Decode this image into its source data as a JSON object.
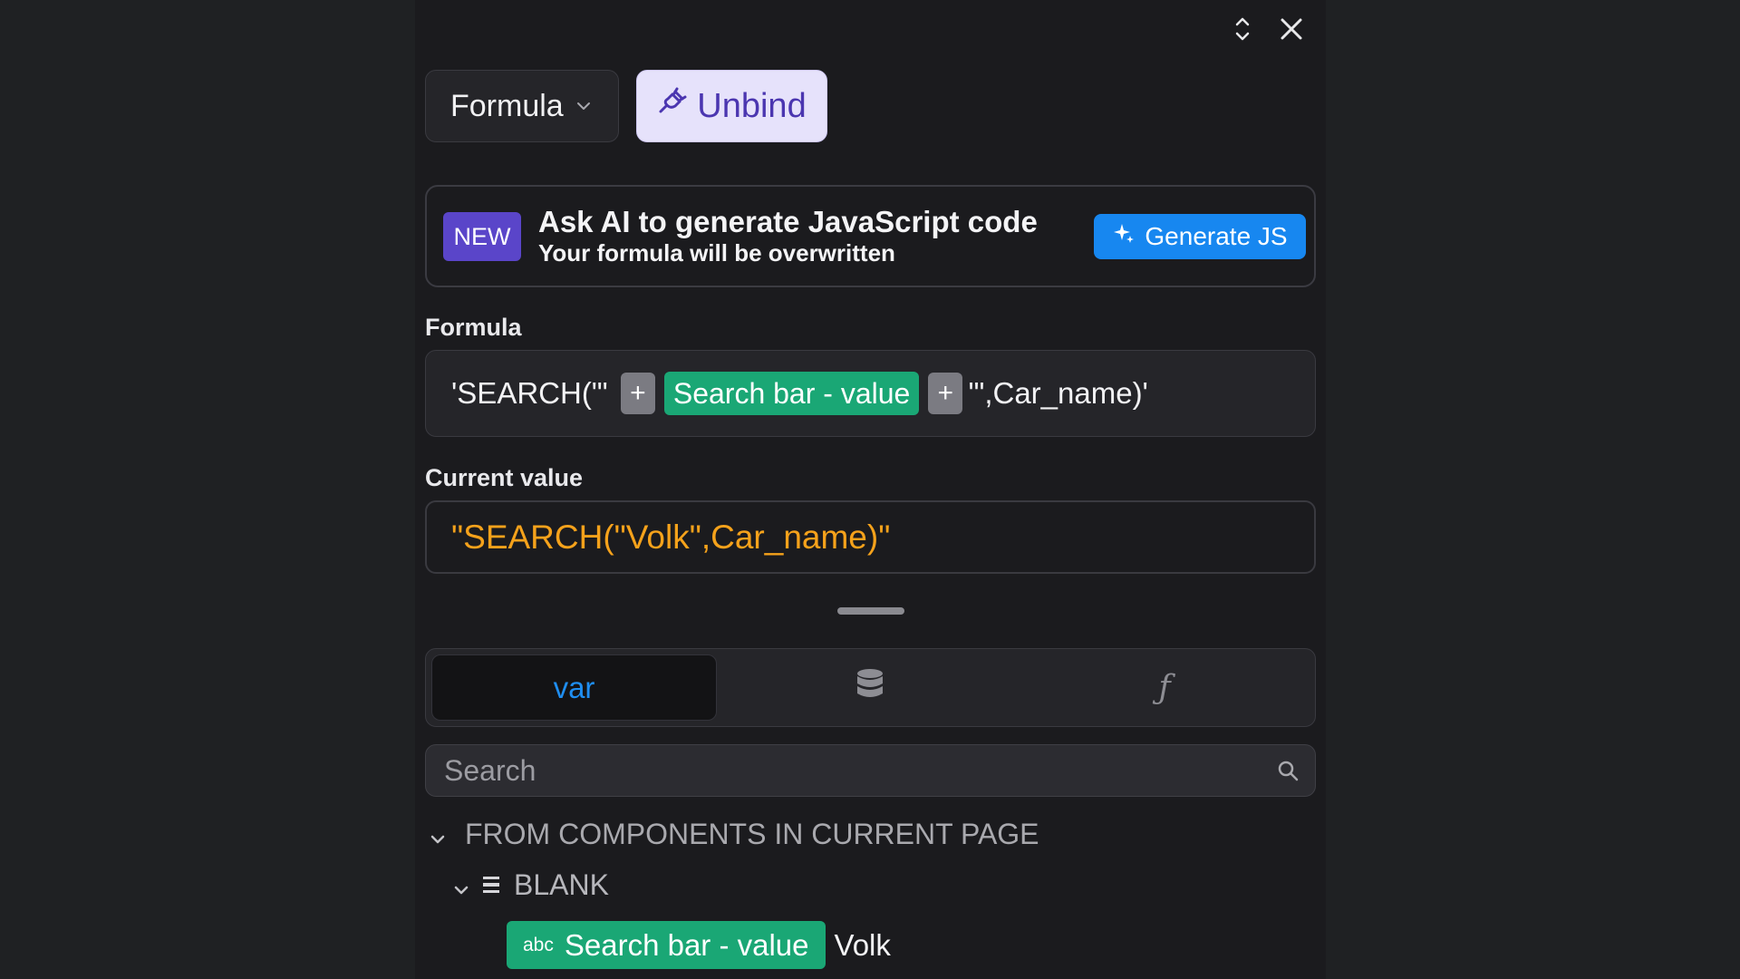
{
  "toolbar": {
    "mode_label": "Formula",
    "unbind_label": "Unbind"
  },
  "ai_banner": {
    "badge": "NEW",
    "title": "Ask AI to generate JavaScript code",
    "subtitle": "Your formula will be overwritten",
    "button_label": "Generate JS"
  },
  "formula": {
    "label": "Formula",
    "prefix": "'SEARCH(\"'",
    "plus": "+",
    "variable_chip": "Search bar - value",
    "suffix": "'\",Car_name)'"
  },
  "current_value": {
    "label": "Current value",
    "value": "\"SEARCH(\"Volk\",Car_name)\""
  },
  "tabs": {
    "var_label": "var",
    "fn_label": "ƒ",
    "active": "var"
  },
  "search": {
    "placeholder": "Search"
  },
  "tree": {
    "group_label": "FROM COMPONENTS IN CURRENT PAGE",
    "section_label": "BLANK",
    "items": [
      {
        "type_badge": "abc",
        "label": "Search bar - value",
        "value": "Volk"
      }
    ]
  },
  "colors": {
    "panel_bg": "#1b1b1e",
    "accent_blue": "#1787f0",
    "unbind_bg": "#e6e2fb",
    "new_badge": "#5a45c9",
    "variable_green": "#1aa775",
    "value_orange": "#f5a21b"
  }
}
